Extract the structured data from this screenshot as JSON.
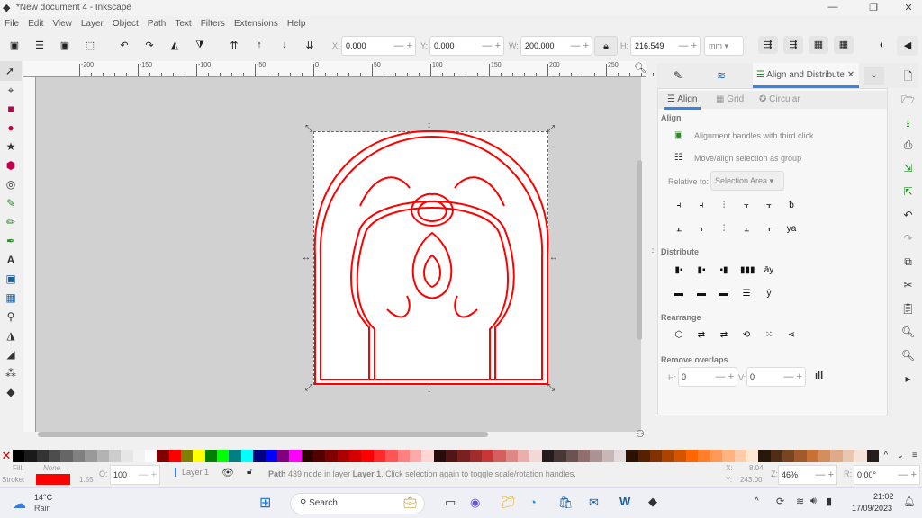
{
  "window": {
    "title": "*New document 4 - Inkscape",
    "controls": [
      "—",
      "❐",
      "✕"
    ]
  },
  "menu": [
    "File",
    "Edit",
    "View",
    "Layer",
    "Object",
    "Path",
    "Text",
    "Filters",
    "Extensions",
    "Help"
  ],
  "toolbar": {
    "x_label": "X:",
    "x": "0.000",
    "y_label": "Y:",
    "y": "0.000",
    "w_label": "W:",
    "w": "200.000",
    "h_label": "H:",
    "h": "216.549",
    "unit": "mm"
  },
  "ruler": {
    "ticks": [
      "-200",
      "-150",
      "-100",
      "-50",
      "0",
      "50",
      "100",
      "150",
      "200",
      "250"
    ]
  },
  "dock": {
    "tab_active": "Align and Distribute",
    "subtabs": [
      "Align",
      "Grid",
      "Circular"
    ],
    "align_section": "Align",
    "option1": "Alignment handles with third click",
    "option2": "Move/align selection as group",
    "relative_label": "Relative to:",
    "relative_value": "Selection Area",
    "distribute_section": "Distribute",
    "rearrange_section": "Rearrange",
    "overlaps_section": "Remove overlaps",
    "h_label": "H:",
    "h_value": "0",
    "v_label": "V:",
    "v_value": "0"
  },
  "palette": [
    "#000000",
    "#1a1a1a",
    "#333333",
    "#4d4d4d",
    "#666666",
    "#808080",
    "#999999",
    "#b3b3b3",
    "#cccccc",
    "#e6e6e6",
    "#f2f2f2",
    "#ffffff",
    "#800000",
    "#ff0000",
    "#808000",
    "#ffff00",
    "#008000",
    "#00ff00",
    "#008080",
    "#00ffff",
    "#000080",
    "#0000ff",
    "#800080",
    "#ff00ff",
    "#2b0000",
    "#550000",
    "#800000",
    "#aa0000",
    "#d40000",
    "#ff0000",
    "#ff2a2a",
    "#ff5555",
    "#ff8080",
    "#ffaaaa",
    "#ffd5d5",
    "#280b0b",
    "#501616",
    "#782121",
    "#a02c2c",
    "#c83737",
    "#d35f5f",
    "#de8787",
    "#e9afaf",
    "#f4d7d7",
    "#241c1c",
    "#483737",
    "#6c5353",
    "#916f6f",
    "#ac9393",
    "#c8b7b7",
    "#e3dbdb",
    "#2b1100",
    "#552200",
    "#803300",
    "#aa4400",
    "#d45500",
    "#ff6600",
    "#ff7f2a",
    "#ff9955",
    "#ffb380",
    "#ffccaa",
    "#ffe6d5",
    "#28170b",
    "#502d16",
    "#784421",
    "#a05a2c",
    "#c87137",
    "#d38d5f",
    "#deaa87",
    "#e9c6af",
    "#f4e3d7",
    "#241f1c"
  ],
  "status": {
    "fill_label": "Fill:",
    "fill_value": "None",
    "stroke_label": "Stroke:",
    "stroke_color": "#ff0000",
    "stroke_width": "1.55",
    "opacity_label": "O:",
    "opacity": "100",
    "layer": "Layer 1",
    "msg_path": "Path",
    "msg_nodes": "439 node in layer",
    "msg_layer": "Layer 1",
    "msg_rest": ". Click selection again to toggle scale/rotation handles.",
    "x_label": "X:",
    "x": "8.04",
    "y_label": "Y:",
    "y": "243.00",
    "zoom_label": "Z:",
    "zoom": "46%",
    "rot_label": "R:",
    "rotation": "0.00°"
  },
  "taskbar": {
    "temp": "14°C",
    "weather": "Rain",
    "search": "Search",
    "time": "21:02",
    "date": "17/09/2023"
  },
  "colors": {
    "accent": "#3584e4",
    "drawing_stroke": "#ff0000"
  }
}
